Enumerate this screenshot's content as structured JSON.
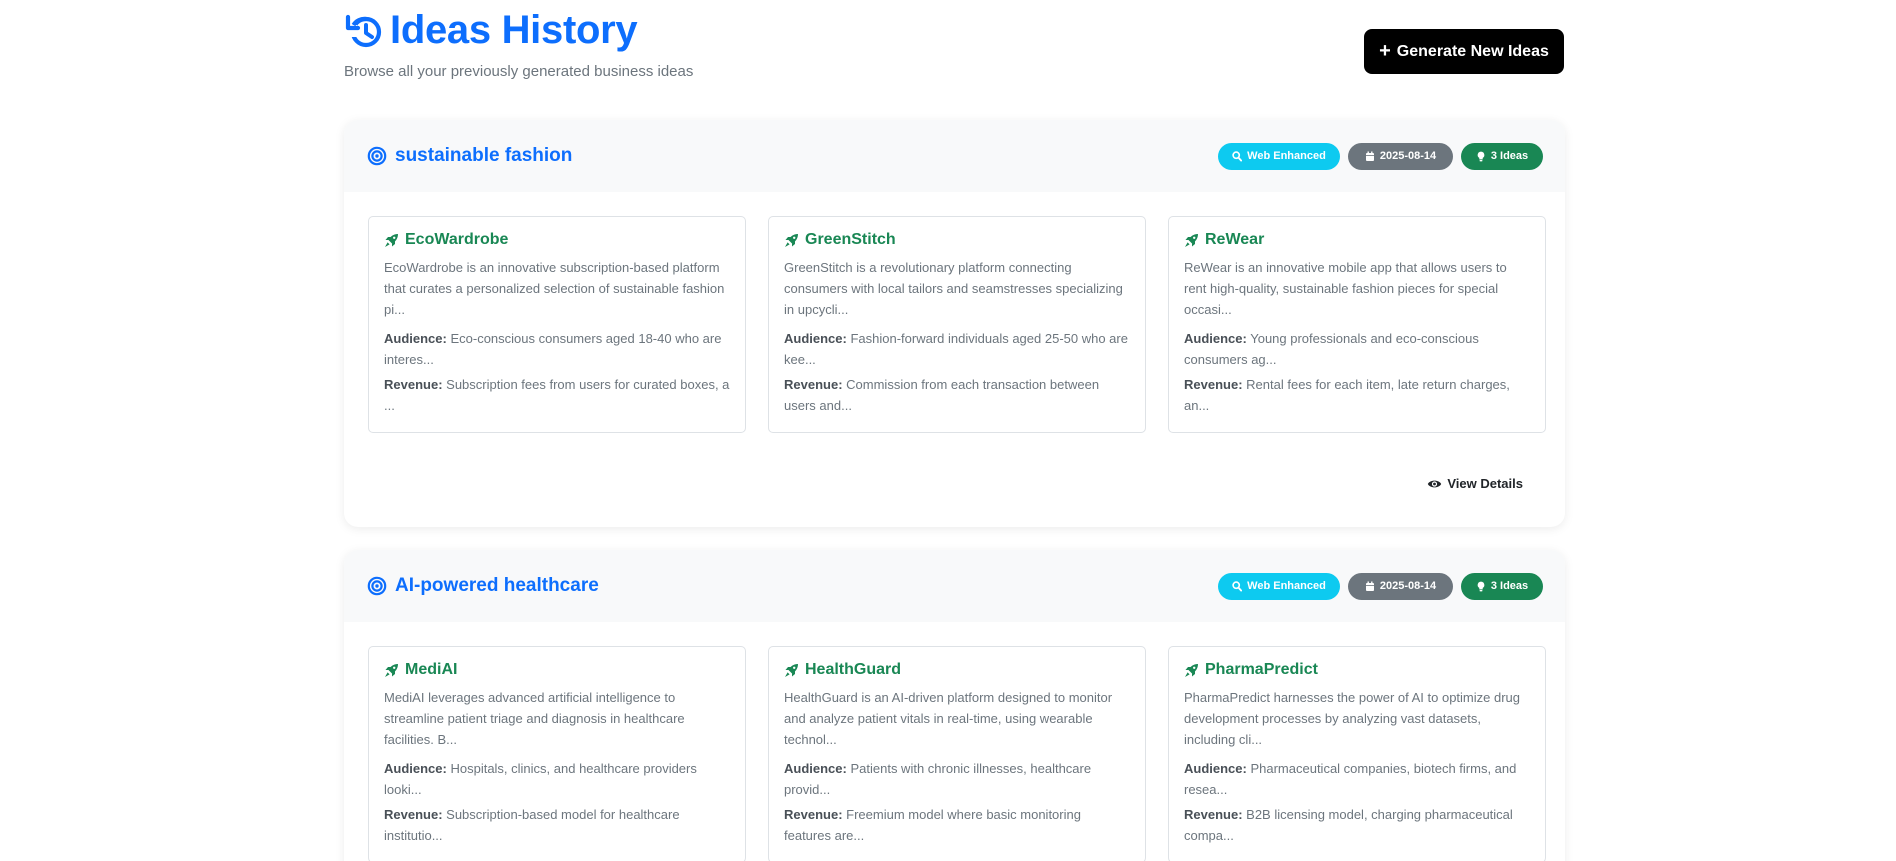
{
  "header": {
    "title": "Ideas History",
    "subtitle": "Browse all your previously generated business ideas",
    "generate_button": "Generate New Ideas"
  },
  "colors": {
    "primary": "#0d6efd",
    "success": "#198754",
    "info": "#0dcaf0",
    "secondary": "#6c757d",
    "button_dark": "#000000"
  },
  "icons": {
    "title": "history-icon",
    "generate": "plus-icon",
    "section": "bullseye-icon",
    "web_badge": "search-icon",
    "date_badge": "calendar-icon",
    "count_badge": "lightbulb-icon",
    "idea": "rocket-icon",
    "view": "eye-icon"
  },
  "sections": [
    {
      "topic": "sustainable fashion",
      "badges": {
        "web": "Web Enhanced",
        "date": "2025-08-14",
        "count": "3 Ideas"
      },
      "view_details": "View Details",
      "ideas": [
        {
          "name": "EcoWardrobe",
          "description": "EcoWardrobe is an innovative subscription-based platform that curates a personalized selection of sustainable fashion pi...",
          "audience_label": "Audience:",
          "audience": "Eco-conscious consumers aged 18-40 who are interes...",
          "revenue_label": "Revenue:",
          "revenue": "Subscription fees from users for curated boxes, a ..."
        },
        {
          "name": "GreenStitch",
          "description": "GreenStitch is a revolutionary platform connecting consumers with local tailors and seamstresses specializing in upcycli...",
          "audience_label": "Audience:",
          "audience": "Fashion-forward individuals aged 25-50 who are kee...",
          "revenue_label": "Revenue:",
          "revenue": "Commission from each transaction between users and..."
        },
        {
          "name": "ReWear",
          "description": "ReWear is an innovative mobile app that allows users to rent high-quality, sustainable fashion pieces for special occasi...",
          "audience_label": "Audience:",
          "audience": "Young professionals and eco-conscious consumers ag...",
          "revenue_label": "Revenue:",
          "revenue": "Rental fees for each item, late return charges, an..."
        }
      ]
    },
    {
      "topic": "AI-powered healthcare",
      "badges": {
        "web": "Web Enhanced",
        "date": "2025-08-14",
        "count": "3 Ideas"
      },
      "view_details": "View Details",
      "ideas": [
        {
          "name": "MediAI",
          "description": "MediAI leverages advanced artificial intelligence to streamline patient triage and diagnosis in healthcare facilities. B...",
          "audience_label": "Audience:",
          "audience": "Hospitals, clinics, and healthcare providers looki...",
          "revenue_label": "Revenue:",
          "revenue": "Subscription-based model for healthcare institutio..."
        },
        {
          "name": "HealthGuard",
          "description": "HealthGuard is an AI-driven platform designed to monitor and analyze patient vitals in real-time, using wearable technol...",
          "audience_label": "Audience:",
          "audience": "Patients with chronic illnesses, healthcare provid...",
          "revenue_label": "Revenue:",
          "revenue": "Freemium model where basic monitoring features are..."
        },
        {
          "name": "PharmaPredict",
          "description": "PharmaPredict harnesses the power of AI to optimize drug development processes by analyzing vast datasets, including cli...",
          "audience_label": "Audience:",
          "audience": "Pharmaceutical companies, biotech firms, and resea...",
          "revenue_label": "Revenue:",
          "revenue": "B2B licensing model, charging pharmaceutical compa..."
        }
      ]
    }
  ]
}
